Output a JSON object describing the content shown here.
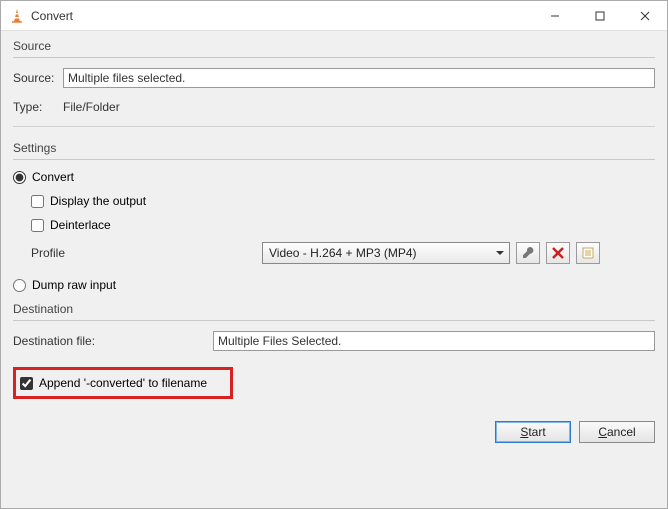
{
  "window": {
    "title": "Convert"
  },
  "source_group": {
    "label": "Source",
    "source_label": "Source:",
    "source_value": "Multiple files selected.",
    "type_label": "Type:",
    "type_value": "File/Folder"
  },
  "settings_group": {
    "label": "Settings",
    "convert_label": "Convert",
    "display_output_label": "Display the output",
    "deinterlace_label": "Deinterlace",
    "profile_label": "Profile",
    "profile_value": "Video - H.264 + MP3 (MP4)",
    "dump_raw_label": "Dump raw input"
  },
  "destination_group": {
    "label": "Destination",
    "dest_file_label": "Destination file:",
    "dest_file_value": "Multiple Files Selected.",
    "append_label": "Append '-converted' to filename"
  },
  "footer": {
    "start_label": "Start",
    "cancel_label": "Cancel"
  },
  "icons": {
    "wrench": "wrench-icon",
    "delete": "delete-icon",
    "new": "new-profile-icon"
  }
}
